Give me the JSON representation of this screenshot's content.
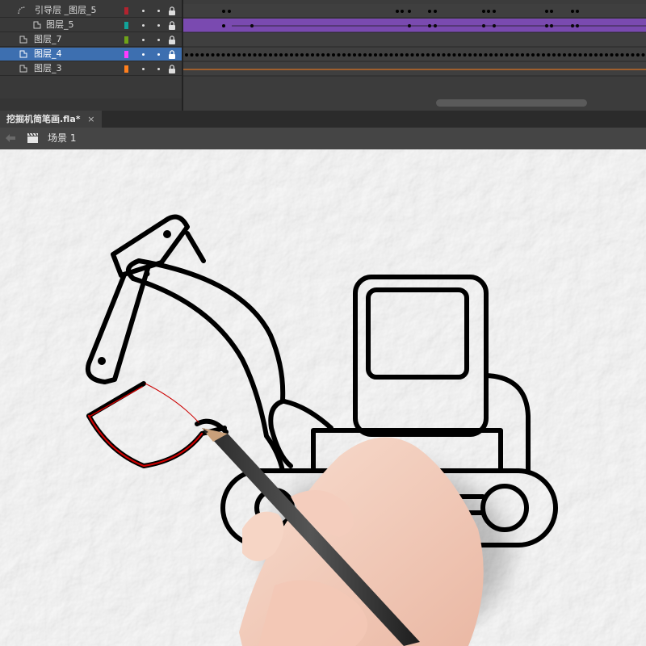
{
  "timeline": {
    "layers": [
      {
        "name": "引导层 _图层_5",
        "type": "guide",
        "color": "#b2232f",
        "selected": false
      },
      {
        "name": "图层_5",
        "type": "normal",
        "color": "#12a39a",
        "selected": false
      },
      {
        "name": "图层_7",
        "type": "normal",
        "color": "#6fa31a",
        "selected": false
      },
      {
        "name": "图层_4",
        "type": "normal",
        "color": "#ff3cff",
        "selected": true
      },
      {
        "name": "图层_3",
        "type": "normal",
        "color": "#ff7f1e",
        "selected": false
      }
    ]
  },
  "doc_tab": {
    "title": "挖掘机简笔画.fla*",
    "close": "×"
  },
  "scene": {
    "label": "场景 1"
  },
  "icons": {
    "guide_layer": "guide-layer-icon",
    "layer": "layer-icon",
    "lock": "lock-icon",
    "back": "back-arrow-icon",
    "scene": "clapper-icon"
  },
  "colors": {
    "selected_row": "#3d6fb0",
    "tween_span": "#7a4ab0",
    "stroke": "#000000",
    "guide_path": "#cc0000"
  }
}
